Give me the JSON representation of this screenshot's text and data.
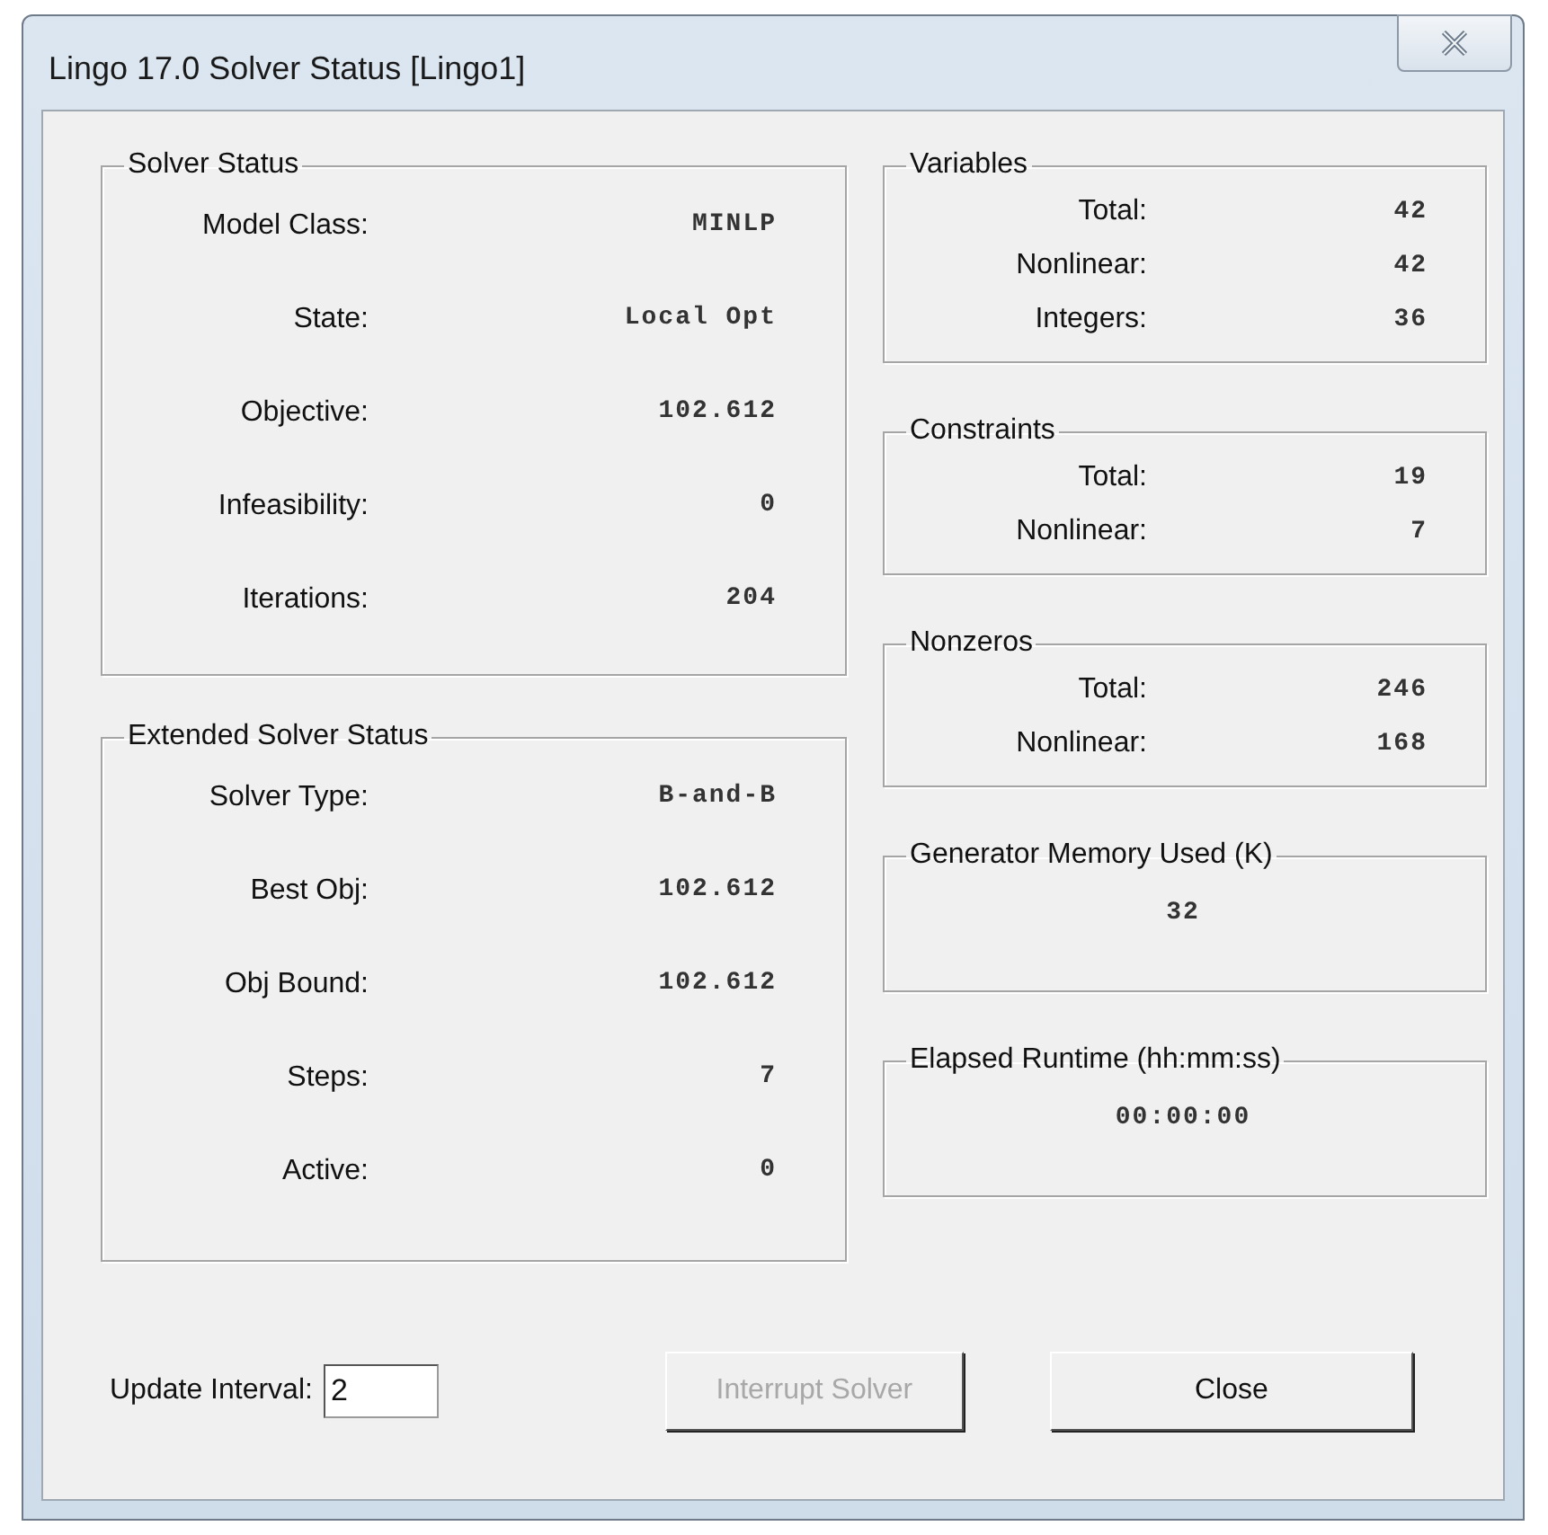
{
  "window": {
    "title": "Lingo 17.0 Solver Status [Lingo1]"
  },
  "left_groups": [
    {
      "title": "Solver Status",
      "rows": [
        {
          "label": "Model Class:",
          "value": "MINLP"
        },
        {
          "label": "State:",
          "value": "Local Opt"
        },
        {
          "label": "Objective:",
          "value": "102.612"
        },
        {
          "label": "Infeasibility:",
          "value": "0"
        },
        {
          "label": "Iterations:",
          "value": "204"
        }
      ]
    },
    {
      "title": "Extended Solver Status",
      "rows": [
        {
          "label": "Solver Type:",
          "value": "B-and-B"
        },
        {
          "label": "Best Obj:",
          "value": "102.612"
        },
        {
          "label": "Obj Bound:",
          "value": "102.612"
        },
        {
          "label": "Steps:",
          "value": "7"
        },
        {
          "label": "Active:",
          "value": "0"
        }
      ]
    }
  ],
  "right_groups": [
    {
      "kind": "rows",
      "title": "Variables",
      "rows": [
        {
          "label": "Total:",
          "value": "42"
        },
        {
          "label": "Nonlinear:",
          "value": "42"
        },
        {
          "label": "Integers:",
          "value": "36"
        }
      ]
    },
    {
      "kind": "rows",
      "title": "Constraints",
      "rows": [
        {
          "label": "Total:",
          "value": "19"
        },
        {
          "label": "Nonlinear:",
          "value": "7"
        }
      ]
    },
    {
      "kind": "rows",
      "title": "Nonzeros",
      "rows": [
        {
          "label": "Total:",
          "value": "246"
        },
        {
          "label": "Nonlinear:",
          "value": "168"
        }
      ]
    },
    {
      "kind": "single",
      "title": "Generator Memory Used (K)",
      "value": "32"
    },
    {
      "kind": "single",
      "title": "Elapsed Runtime (hh:mm:ss)",
      "value": "00:00:00"
    }
  ],
  "update_interval": {
    "label": "Update Interval:",
    "value": "2"
  },
  "buttons": [
    {
      "label": "Interrupt Solver",
      "disabled": true
    },
    {
      "label": "Close",
      "disabled": false
    }
  ]
}
